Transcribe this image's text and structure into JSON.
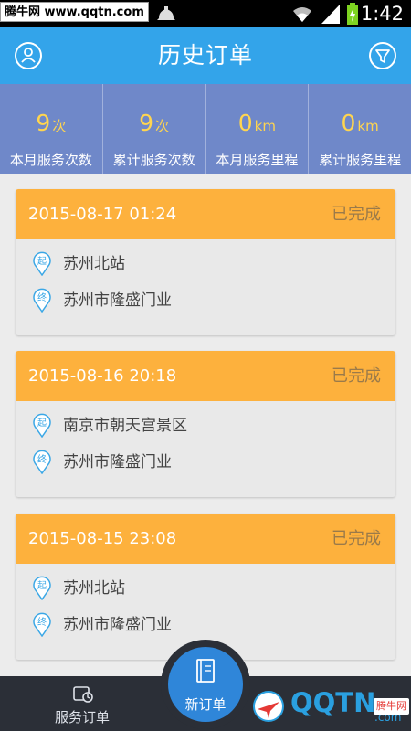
{
  "status_bar": {
    "watermark": "腾牛网 www.qqtn.com",
    "time": "1:42"
  },
  "header": {
    "title": "历史订单",
    "left_icon": "profile-icon",
    "right_icon": "filter-icon"
  },
  "stats": [
    {
      "value": "9",
      "unit": "次",
      "label": "本月服务次数"
    },
    {
      "value": "9",
      "unit": "次",
      "label": "累计服务次数"
    },
    {
      "value": "0",
      "unit": "km",
      "label": "本月服务里程"
    },
    {
      "value": "0",
      "unit": "km",
      "label": "累计服务里程"
    }
  ],
  "orders": [
    {
      "datetime": "2015-08-17 01:24",
      "status": "已完成",
      "start_tag": "起",
      "start": "苏州北站",
      "end_tag": "终",
      "end": "苏州市隆盛门业"
    },
    {
      "datetime": "2015-08-16 20:18",
      "status": "已完成",
      "start_tag": "起",
      "start": "南京市朝天宫景区",
      "end_tag": "终",
      "end": "苏州市隆盛门业"
    },
    {
      "datetime": "2015-08-15 23:08",
      "status": "已完成",
      "start_tag": "起",
      "start": "苏州北站",
      "end_tag": "终",
      "end": "苏州市隆盛门业"
    }
  ],
  "nav": {
    "service_orders": "服务订单",
    "new_order": "新订单"
  },
  "logo": {
    "text": "QQTN",
    "suffix": ".com",
    "badge": "腾牛网"
  },
  "colors": {
    "header": "#33a4ea",
    "stats_bg": "#6f88c9",
    "stat_value": "#ffd54f",
    "order_head": "#fdb13d",
    "nav_bg": "#2b2f37",
    "new_order": "#2f86d9"
  }
}
